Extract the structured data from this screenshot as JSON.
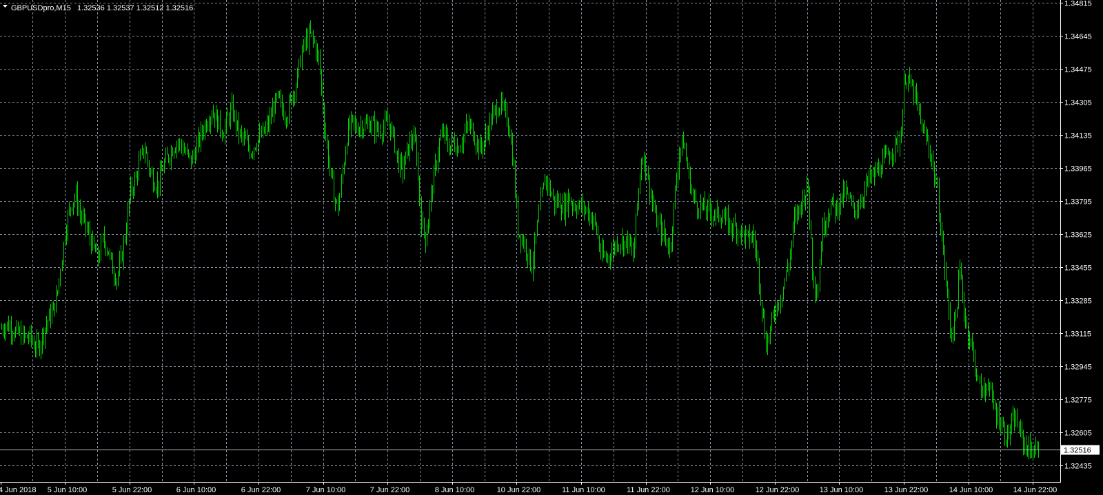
{
  "header": {
    "symbol_text": "GBPUSDpro,M15",
    "ohlc_text": "1.32536 1.32537 1.32512 1.32516",
    "menu_icon": "triangle-down-icon"
  },
  "colors": {
    "background": "#000000",
    "bars": "#00d200",
    "grid": "#8a94a6",
    "axis": "#ffffff",
    "price_line": "#c0c0c0",
    "price_tag_bg": "#ffffff",
    "price_tag_text": "#000000"
  },
  "chart_data": {
    "type": "line",
    "title": "GBPUSDpro,M15",
    "grid": true,
    "ylim": [
      1.3235,
      1.3483
    ],
    "y_ticks": [
      "1.34815",
      "1.34645",
      "1.34475",
      "1.34305",
      "1.34135",
      "1.33965",
      "1.33795",
      "1.33625",
      "1.33455",
      "1.33285",
      "1.33115",
      "1.32945",
      "1.32775",
      "1.32605",
      "1.32435"
    ],
    "x_ticks": [
      "4 Jun 2018",
      "5 Jun 10:00",
      "5 Jun 22:00",
      "6 Jun 10:00",
      "6 Jun 22:00",
      "7 Jun 10:00",
      "7 Jun 22:00",
      "8 Jun 10:00",
      "10 Jun 22:00",
      "11 Jun 10:00",
      "11 Jun 22:00",
      "12 Jun 10:00",
      "12 Jun 22:00",
      "13 Jun 10:00",
      "13 Jun 22:00",
      "14 Jun 10:00",
      "14 Jun 22:00"
    ],
    "current_price": "1.32516",
    "series": [
      {
        "name": "GBPUSDpro,M15",
        "x_range": [
          "4 Jun 2018",
          "14 Jun 22:00"
        ],
        "values": [
          1.3314,
          1.3316,
          1.3315,
          1.3312,
          1.3311,
          1.3309,
          1.331,
          1.3306,
          1.3304,
          1.3312,
          1.3318,
          1.3322,
          1.333,
          1.335,
          1.3368,
          1.3378,
          1.3383,
          1.3373,
          1.3368,
          1.3362,
          1.3355,
          1.335,
          1.336,
          1.3355,
          1.3345,
          1.334,
          1.335,
          1.3365,
          1.3385,
          1.339,
          1.34,
          1.3407,
          1.3396,
          1.339,
          1.3388,
          1.3397,
          1.3402,
          1.3406,
          1.341,
          1.3408,
          1.3404,
          1.34,
          1.3405,
          1.3412,
          1.3418,
          1.3423,
          1.3426,
          1.342,
          1.3415,
          1.3422,
          1.3427,
          1.3418,
          1.3412,
          1.341,
          1.3405,
          1.3409,
          1.3412,
          1.3415,
          1.342,
          1.3428,
          1.3432,
          1.3426,
          1.3424,
          1.3434,
          1.344,
          1.3455,
          1.3462,
          1.3465,
          1.346,
          1.345,
          1.342,
          1.34,
          1.3385,
          1.3375,
          1.3395,
          1.3415,
          1.342,
          1.3417,
          1.3419,
          1.3418,
          1.342,
          1.3417,
          1.3416,
          1.3418,
          1.342,
          1.3412,
          1.34,
          1.3395,
          1.3405,
          1.3412,
          1.3408,
          1.337,
          1.336,
          1.338,
          1.3395,
          1.341,
          1.3415,
          1.3407,
          1.341,
          1.3407,
          1.3412,
          1.3418,
          1.3417,
          1.341,
          1.3406,
          1.3412,
          1.342,
          1.3425,
          1.343,
          1.3425,
          1.342,
          1.34,
          1.3365,
          1.336,
          1.3355,
          1.3345,
          1.336,
          1.338,
          1.3392,
          1.3385,
          1.3378,
          1.338,
          1.3375,
          1.3382,
          1.3378,
          1.3377,
          1.3376,
          1.3375,
          1.3371,
          1.3366,
          1.3352,
          1.335,
          1.3352,
          1.3356,
          1.336,
          1.3358,
          1.3359,
          1.335,
          1.338,
          1.3405,
          1.3395,
          1.3382,
          1.337,
          1.3365,
          1.336,
          1.3355,
          1.338,
          1.3405,
          1.341,
          1.3395,
          1.3382,
          1.3378,
          1.3376,
          1.3375,
          1.3374,
          1.3372,
          1.3373,
          1.337,
          1.3367,
          1.3366,
          1.3365,
          1.3362,
          1.336,
          1.3362,
          1.335,
          1.3325,
          1.3305,
          1.3315,
          1.3325,
          1.333,
          1.334,
          1.335,
          1.337,
          1.3375,
          1.3382,
          1.3388,
          1.3345,
          1.333,
          1.3365,
          1.3372,
          1.3378,
          1.3375,
          1.338,
          1.3384,
          1.338,
          1.3374,
          1.3378,
          1.3384,
          1.339,
          1.3392,
          1.3395,
          1.3398,
          1.3402,
          1.3405,
          1.3408,
          1.3412,
          1.3445,
          1.344,
          1.3435,
          1.3425,
          1.3415,
          1.341,
          1.34,
          1.3385,
          1.336,
          1.3335,
          1.331,
          1.332,
          1.3345,
          1.332,
          1.331,
          1.33,
          1.3285,
          1.328,
          1.3288,
          1.3275,
          1.327,
          1.3265,
          1.3258,
          1.3262,
          1.3268,
          1.326,
          1.3254,
          1.3252,
          1.3251,
          1.3252
        ]
      }
    ]
  }
}
